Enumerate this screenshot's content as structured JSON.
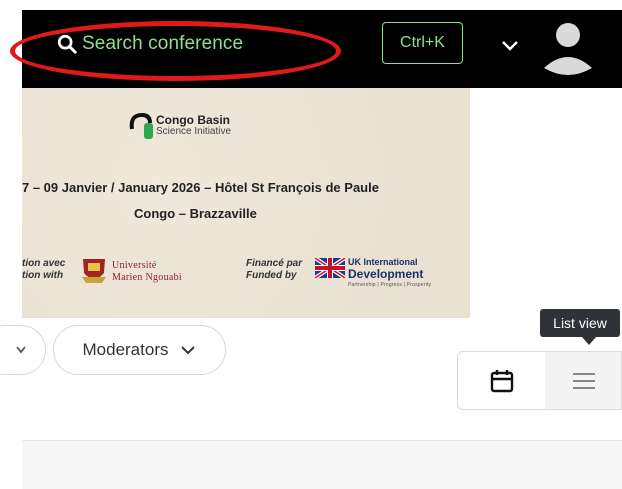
{
  "header": {
    "search_placeholder": "Search conference",
    "shortcut": "Ctrl+K",
    "icons": [
      "search-icon",
      "chevron-down-icon",
      "user-avatar-icon"
    ],
    "search_text_color": "#8fe08b",
    "highlight_color": "#e01a1a"
  },
  "banner": {
    "org_name": "Congo Basin",
    "org_subtitle": "Science Initiative",
    "dates": "7 – 09 Janvier / January 2026 – Hôtel St François de Paule",
    "city": "Congo – Brazzaville",
    "partner_line_fr": "tion avec",
    "partner_line_en": "tion with",
    "university_line1": "Université",
    "university_line2": "Marien Ngouabi",
    "funded_fr": "Financé par",
    "funded_en": "Funded by",
    "ukid_line1": "UK International",
    "ukid_line2": "Development",
    "ukid_tagline": "Partnership | Progress | Prosperity"
  },
  "filters": {
    "moderators_label": "Moderators"
  },
  "view_toggle": {
    "tooltip": "List view",
    "options": [
      "calendar-view",
      "list-view"
    ],
    "active": "calendar-view"
  }
}
